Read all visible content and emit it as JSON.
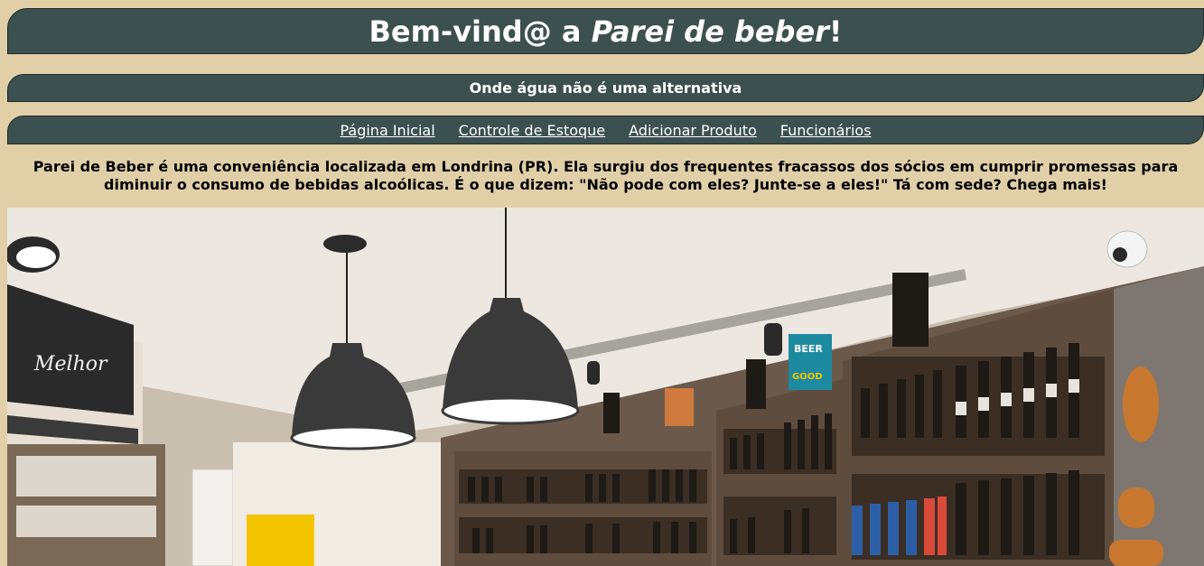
{
  "header": {
    "title_prefix": "Bem-vind@ a ",
    "title_brand": "Parei de beber",
    "title_suffix": "!"
  },
  "subheader": {
    "tagline": "Onde água não é uma alternativa"
  },
  "nav": {
    "items": [
      {
        "label": "Página Inicial"
      },
      {
        "label": "Controle de Estoque"
      },
      {
        "label": "Adicionar Produto"
      },
      {
        "label": "Funcionários"
      }
    ]
  },
  "main": {
    "intro": "Parei de Beber é uma conveniência localizada em Londrina (PR). Ela surgiu dos frequentes fracassos dos sócios em cumprir promessas para diminuir o consumo de bebidas alcoólicas. É o que dizem: \"Não pode com eles? Junte-se a eles!\" Tá com sede? Chega mais!"
  },
  "photo": {
    "sign_text": "Melhor",
    "box_text": "BEER",
    "box_text2": "GOOD"
  },
  "colors": {
    "page_background": "#e1cfa8",
    "bar_background": "#3c5050",
    "bar_text": "#ffffff"
  }
}
